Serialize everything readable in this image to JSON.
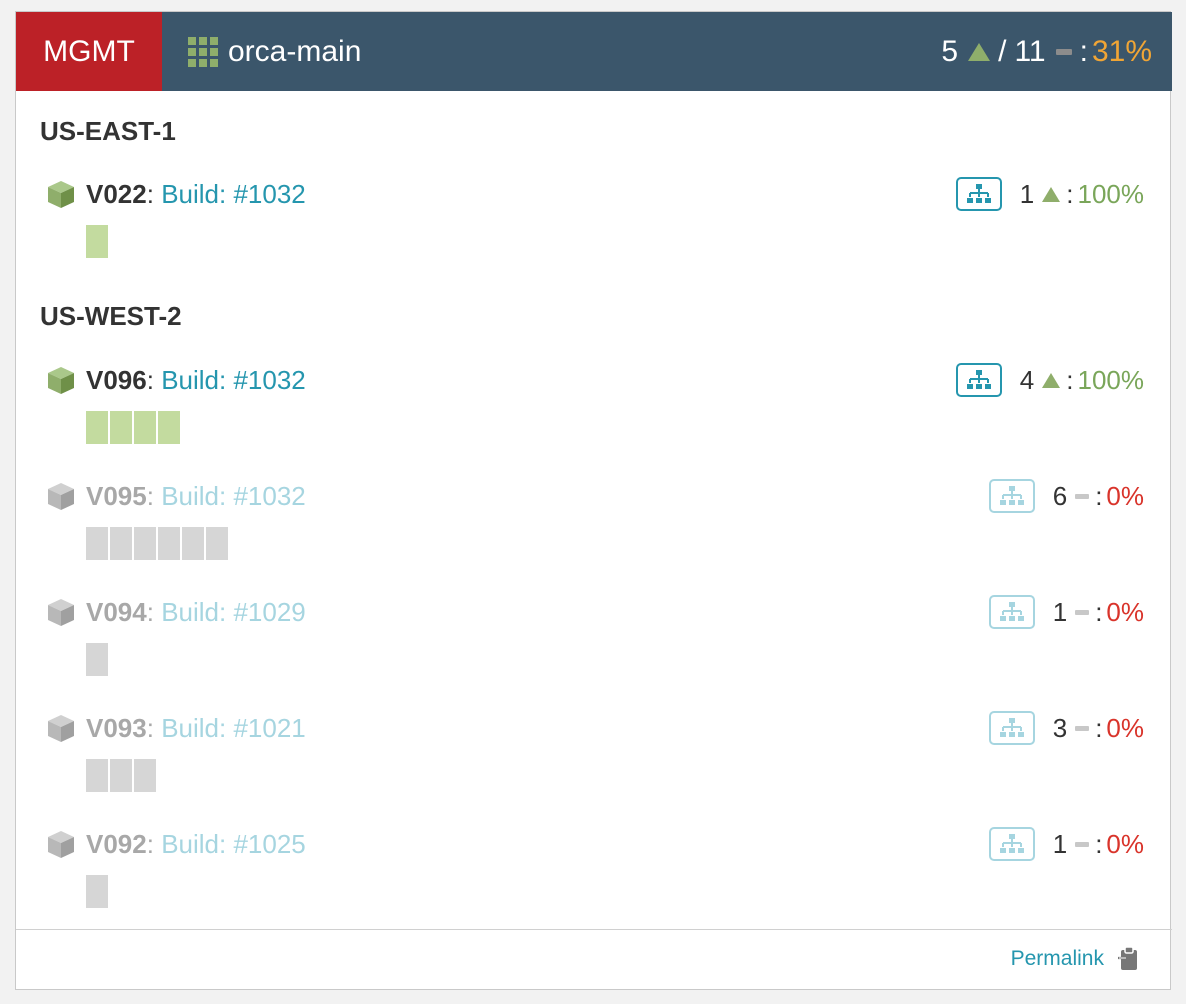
{
  "header": {
    "environment": "MGMT",
    "app_name": "orca-main",
    "app_icon": "grid-icon",
    "up_count": "5",
    "separator": "/",
    "total_count": "11",
    "colon": ":",
    "percent": "31%"
  },
  "regions": [
    {
      "name": "US-EAST-1",
      "server_groups": [
        {
          "version": "V022",
          "build_label": "Build: #1032",
          "count": "1",
          "status": "up",
          "percent": "100%",
          "instances": [
            "up"
          ]
        }
      ]
    },
    {
      "name": "US-WEST-2",
      "server_groups": [
        {
          "version": "V096",
          "build_label": "Build: #1032",
          "count": "4",
          "status": "up",
          "percent": "100%",
          "instances": [
            "up",
            "up",
            "up",
            "up"
          ]
        },
        {
          "version": "V095",
          "build_label": "Build: #1032",
          "count": "6",
          "status": "disabled",
          "percent": "0%",
          "instances": [
            "down",
            "down",
            "down",
            "down",
            "down",
            "down"
          ]
        },
        {
          "version": "V094",
          "build_label": "Build: #1029",
          "count": "1",
          "status": "disabled",
          "percent": "0%",
          "instances": [
            "down"
          ]
        },
        {
          "version": "V093",
          "build_label": "Build: #1021",
          "count": "3",
          "status": "disabled",
          "percent": "0%",
          "instances": [
            "down",
            "down",
            "down"
          ]
        },
        {
          "version": "V092",
          "build_label": "Build: #1025",
          "count": "1",
          "status": "disabled",
          "percent": "0%",
          "instances": [
            "down"
          ]
        }
      ]
    }
  ],
  "footer": {
    "permalink_label": "Permalink",
    "permalink_icon": "clipboard-icon"
  },
  "colors": {
    "env_badge": "#bc2127",
    "header_bg": "#3b566b",
    "link": "#2596ae",
    "healthy": "#7aa65a",
    "unhealthy": "#d9342b",
    "summary_percent": "#f0a535"
  }
}
